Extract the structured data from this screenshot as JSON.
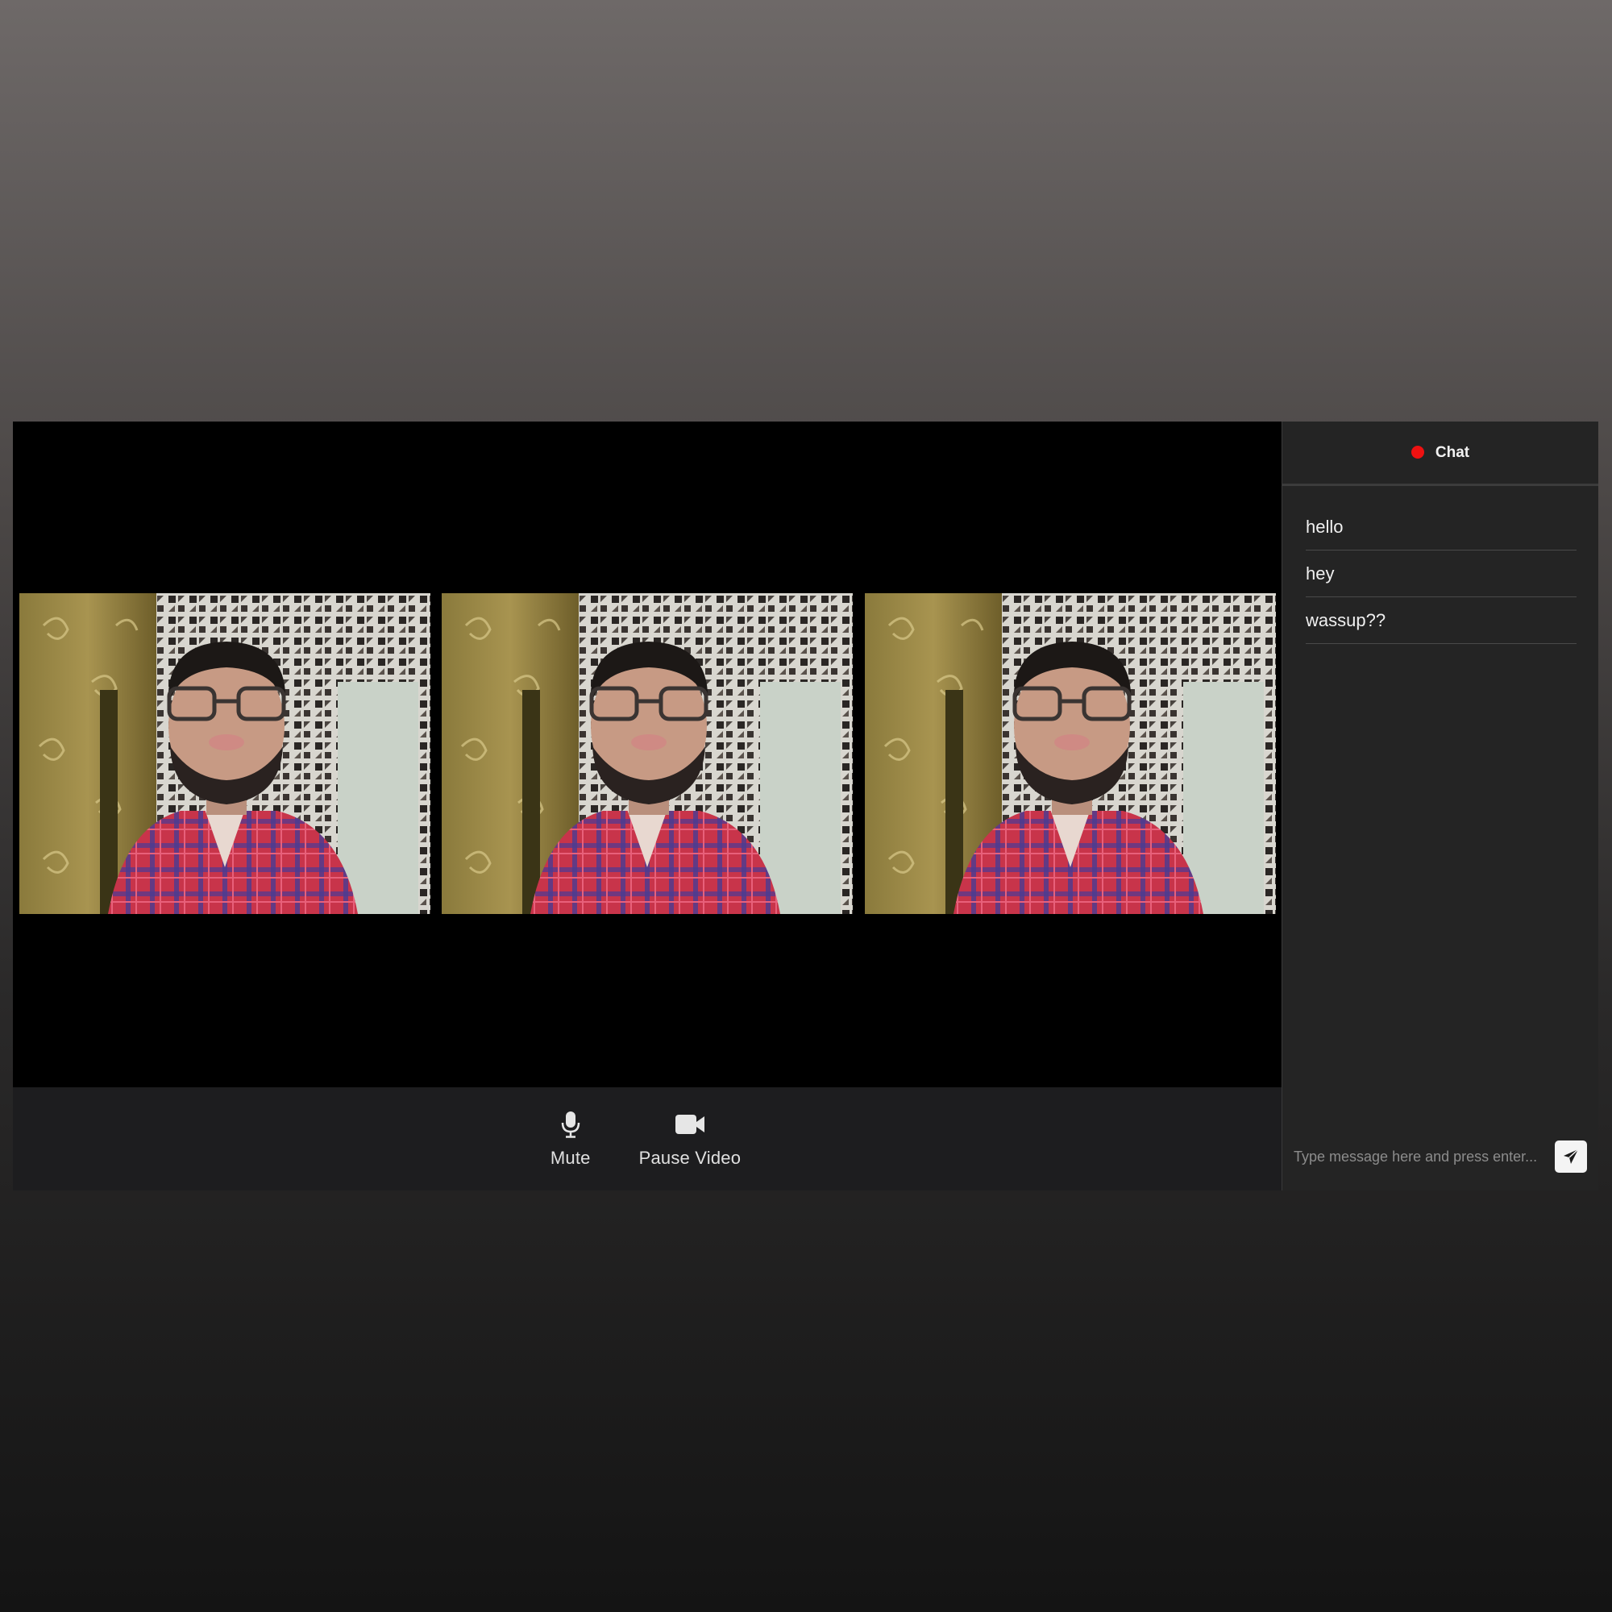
{
  "controls": {
    "mute_label": "Mute",
    "pause_video_label": "Pause Video",
    "mute_icon": "microphone-icon",
    "pause_video_icon": "video-camera-icon"
  },
  "video_tiles": [
    {
      "subject": "participant-video"
    },
    {
      "subject": "participant-video"
    },
    {
      "subject": "participant-video"
    }
  ],
  "chat": {
    "title": "Chat",
    "status_color": "#ee1111",
    "messages": [
      "hello",
      "hey",
      "wassup??"
    ],
    "input_placeholder": "Type message here and press enter...",
    "send_icon": "paper-plane-icon"
  },
  "colors": {
    "stage_background": "#000000",
    "control_bar": "#1d1d1f",
    "chat_panel": "#242424"
  }
}
